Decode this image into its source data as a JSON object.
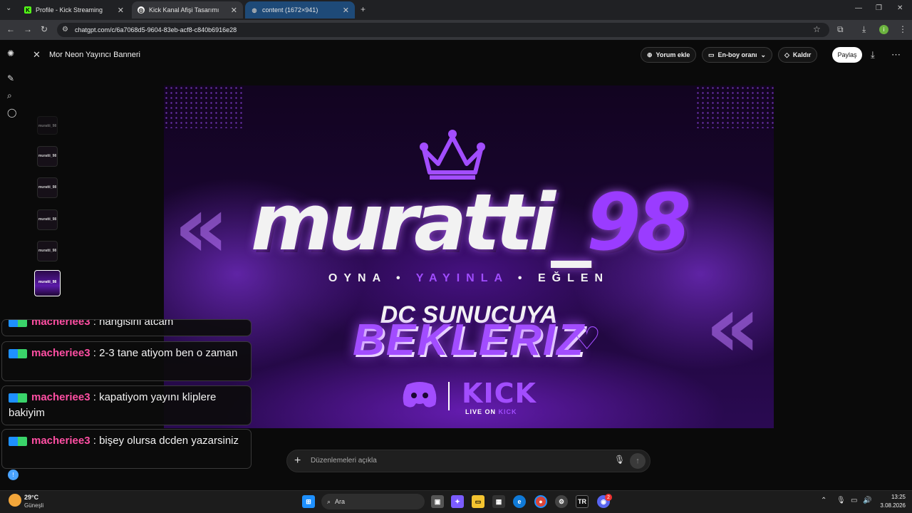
{
  "browser": {
    "tabs": [
      {
        "label": "Profile - Kick Streaming"
      },
      {
        "label": "Kick Kanal Afişi Tasarımı"
      },
      {
        "label": "content (1672×941)"
      }
    ],
    "url": "chatgpt.com/c/6a7068d5-9604-83eb-acf8-c840b6916e28"
  },
  "header": {
    "title": "Mor Neon Yayıncı Banneri",
    "add_comment": "Yorum ekle",
    "aspect_ratio": "En-boy oranı",
    "remove": "Kaldır",
    "share": "Paylaş"
  },
  "thumbnails": [
    "muratti_98",
    "muratti_98",
    "muratti_98",
    "muratti_98",
    "muratti_98"
  ],
  "banner": {
    "name_main": "muratti_",
    "name_num": "98",
    "tagline_left": "OYNA",
    "tagline_mid": "YAYINLA",
    "tagline_right": "EĞLEN",
    "dc_line": "DC SUNUCUYA",
    "bekleriz": "BEKLERIZ",
    "kick_logo": "KICK",
    "live_on": "LIVE ON",
    "live_on_kick": "KICK"
  },
  "chat": [
    {
      "user": "macheriee3",
      "text": "hangisini atcam"
    },
    {
      "user": "macheriee3",
      "text": "2-3 tane atiyom ben o zaman"
    },
    {
      "user": "macheriee3",
      "text": "kapatiyom yayını kliplere bakiyim"
    },
    {
      "user": "macheriee3",
      "text": "bişey olursa dcden yazarsiniz"
    }
  ],
  "prompt": {
    "placeholder": "Düzenlemeleri açıkla"
  },
  "taskbar": {
    "weather_temp": "29°C",
    "weather_desc": "Güneşli",
    "search_label": "Ara",
    "time": "13:25",
    "date": "3.08.2026",
    "discord_badge": "2"
  },
  "colors": {
    "accent_purple": "#a24dff",
    "chat_user": "#ff4fa3",
    "banner_bg": "#1b0634"
  }
}
